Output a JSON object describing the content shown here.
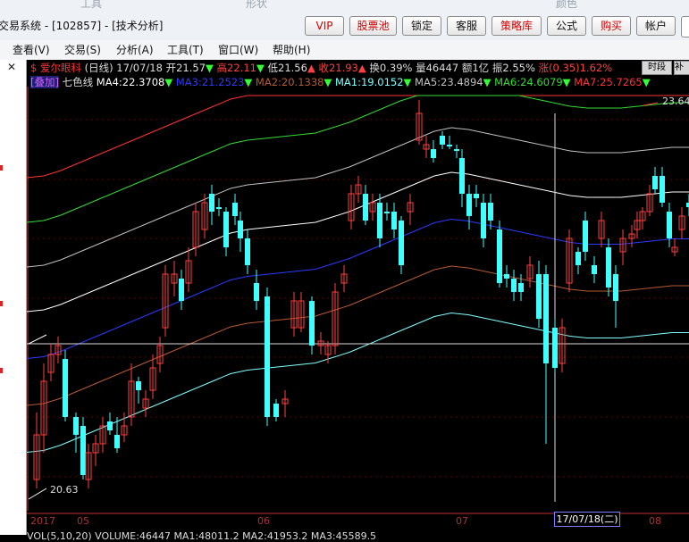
{
  "window": {
    "title": "交易系统 - [102857] - [技术分析]",
    "ghost_labels": [
      "工具",
      "形状",
      "颜色"
    ]
  },
  "toolbar": [
    {
      "label": "VIP",
      "red": true
    },
    {
      "label": "股票池",
      "red": true
    },
    {
      "label": "锁定",
      "red": false
    },
    {
      "label": "客服",
      "red": false
    },
    {
      "label": "策略库",
      "red": true
    },
    {
      "label": "公式",
      "red": false
    },
    {
      "label": "购买",
      "red": true
    },
    {
      "label": "帐户",
      "red": false
    }
  ],
  "menu": [
    "查看(V)",
    "交易(S)",
    "分析(A)",
    "工具(T)",
    "窗口(W)",
    "帮助(H)"
  ],
  "left_strip": {
    "close": "✕"
  },
  "stock": {
    "flag": "$",
    "name": "爱尔眼科",
    "period": "(日线)",
    "date": "17/07/18",
    "open": "开21.57",
    "high": "高22.11",
    "low": "低21.56",
    "close": "收21.93",
    "turnover": "换0.39%",
    "volume": "量46447",
    "amount": "额1亿",
    "amplitude": "振2.55%",
    "change": "涨(0.35)1.62%"
  },
  "buttons": {
    "time": "时段",
    "more": "补"
  },
  "indicator": {
    "overlay_tag": "[叠加]",
    "name": "七色线",
    "lines": [
      {
        "label": "MA4:22.3708",
        "color": "#ffffff"
      },
      {
        "label": "MA3:21.2523",
        "color": "#2a3bff"
      },
      {
        "label": "MA2:20.1338",
        "color": "#b85a33"
      },
      {
        "label": "MA1:19.0152",
        "color": "#7fffff"
      },
      {
        "label": "MA5:23.4894",
        "color": "#c0c0c0"
      },
      {
        "label": "MA6:24.6079",
        "color": "#33dd33"
      },
      {
        "label": "MA7:25.7265",
        "color": "#ff3333"
      }
    ]
  },
  "price_labels": {
    "high": "23.64",
    "low": "20.63"
  },
  "x_labels": {
    "year": "2017",
    "m05": "05",
    "m06": "06",
    "m07": "07",
    "m08": "08"
  },
  "crosshair_date": "17/07/18(二)",
  "volume_line": "VOL(5,10,20)  VOLUME:46447  MA1:48011.2  MA2:41953.2  MA3:45589.5",
  "colors": {
    "up": "#ff4040",
    "down": "#40ffff",
    "bg": "#000000"
  }
}
